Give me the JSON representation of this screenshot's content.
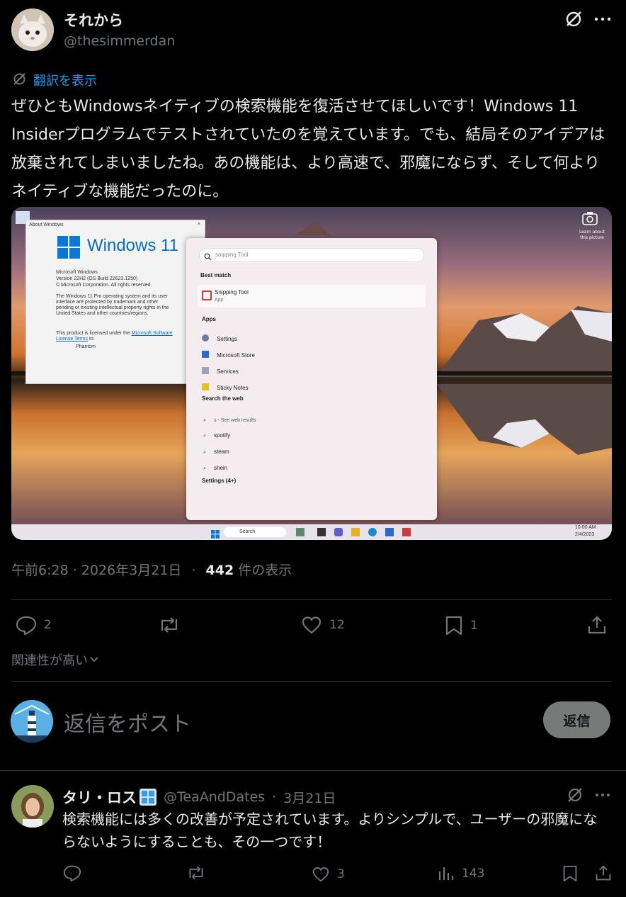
{
  "post": {
    "display_name": "それから",
    "handle": "@thesimmerdan",
    "translate_label": "翻訳を表示",
    "body": "ぜひともWindowsネイティブの検索機能を復活させてほしいです！Windows 11 Insiderプログラムでテストされていたのを覚えています。でも、結局そのアイデアは放棄されてしまいましたね。あの機能は、より高速で、邪魔にならず、そして何よりネイティブな機能だったのに。",
    "time": "午前6:28 · 2026年3月21日",
    "dot": "·",
    "views_count": "442",
    "views_label": "件の表示",
    "replies": "2",
    "reposts": "",
    "likes": "12",
    "bookmarks": "1"
  },
  "screenshot": {
    "about_title": "About Windows",
    "windows_logo_text": "Windows 11",
    "about_lines": [
      "Microsoft Windows",
      "Version 22H2 (OS Build 22623.1250)",
      "© Microsoft Corporation. All rights reserved."
    ],
    "about_para": "The Windows 11 Pro operating system and its user interface are protected by trademark and other pending or existing intellectual property rights in the United States and other countries/regions.",
    "license_text": "This product is licensed under the",
    "license_link": "Microsoft Software License Terms",
    "license_to": "to:",
    "licensee": "Phantom",
    "search_query": "snipping Tool",
    "best_match_label": "Best match",
    "best_match_title": "Snipping Tool",
    "best_match_sub": "App",
    "apps_label": "Apps",
    "apps": [
      "Settings",
      "Microsoft Store",
      "Services",
      "Sticky Notes"
    ],
    "web_label": "Search the web",
    "web_items": [
      "s - See web results",
      "spotify",
      "steam",
      "shein"
    ],
    "settings_more": "Settings (4+)",
    "taskbar_search": "Search",
    "clock_time": "10:00 AM",
    "clock_date": "2/4/2023",
    "learn_text": "Learn about this picture"
  },
  "sort": {
    "label": "関連性が高い"
  },
  "composer": {
    "placeholder": "返信をポスト",
    "button": "返信"
  },
  "reply": {
    "display_name": "タリ・ロス",
    "handle": "@TeaAndDates",
    "dot": "·",
    "date": "3月21日",
    "body": "検索機能には多くの改善が予定されています。よりシンプルで、ユーザーの邪魔にならないようにすることも、その一つです！",
    "replies": "",
    "reposts": "",
    "likes": "3",
    "views": "143"
  },
  "icons": [
    "grok-icon",
    "more-icon",
    "translate-icon",
    "reply-icon",
    "repost-icon",
    "like-icon",
    "bookmark-icon",
    "share-icon",
    "views-icon",
    "chevron-down-icon"
  ],
  "colors": {
    "link": "#1d9bf0",
    "muted": "#71767b",
    "text": "#e7e9ea",
    "button": "#787a7a"
  }
}
